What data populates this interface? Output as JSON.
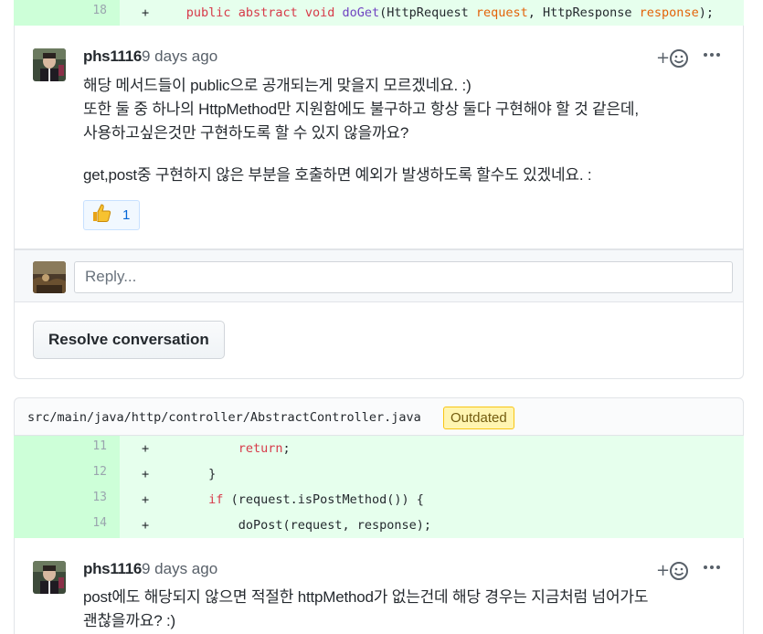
{
  "diff_top": {
    "line": "18",
    "marker": "+",
    "code": {
      "kw1": "public",
      "kw2": "abstract",
      "kw3": "void",
      "fn": "doGet",
      "p1": "(HttpRequest ",
      "a1": "request",
      "p2": ", HttpResponse ",
      "a2": "response",
      "p3": ");"
    }
  },
  "thread1": {
    "comment": {
      "author": "phs1116",
      "time": "9 days ago",
      "paragraph1_line1": "해당 메서드들이 public으로 공개되는게 맞을지 모르겠네요. :)",
      "paragraph1_line2": "또한 둘 중 하나의 HttpMethod만 지원함에도 불구하고 항상 둘다 구현해야 할 것 같은데,",
      "paragraph1_line3": "사용하고싶은것만 구현하도록 할 수 있지 않을까요?",
      "paragraph2": "get,post중 구현하지 않은 부분을 호출하면 예외가 발생하도록 할수도 있겠네요. :",
      "reaction_emoji": "👍",
      "reaction_count": "1",
      "add_reaction": "+☺",
      "more": "•••"
    },
    "reply_placeholder": "Reply...",
    "resolve_label": "Resolve conversation"
  },
  "file": {
    "path": "src/main/java/http/controller/AbstractController.java",
    "badge": "Outdated"
  },
  "diff_lines": [
    {
      "line": "11",
      "marker": "+",
      "indent": "            ",
      "kw": "return",
      "rest": ";"
    },
    {
      "line": "12",
      "marker": "+",
      "indent": "        ",
      "kw": "",
      "rest": "}"
    },
    {
      "line": "13",
      "marker": "+",
      "indent": "        ",
      "kw": "if",
      "rest": " (request.isPostMethod()) {"
    },
    {
      "line": "14",
      "marker": "+",
      "indent": "            ",
      "kw": "",
      "rest": "doPost(request, response);"
    }
  ],
  "thread2": {
    "comment": {
      "author": "phs1116",
      "time": "9 days ago",
      "line1": "post에도 해당되지 않으면 적절한 httpMethod가 없는건데 해당 경우는 지금처럼 넘어가도",
      "line2": "괜찮을까요? :)",
      "add_reaction": "+☺",
      "more": "•••"
    }
  },
  "colors": {
    "addition_bg": "#e6ffed",
    "addition_num_bg": "#cdffd8",
    "keyword": "#d73a49",
    "function": "#6f42c1",
    "param": "#e36209",
    "link": "#0366d6",
    "outdated_bg": "#fff5b1"
  }
}
